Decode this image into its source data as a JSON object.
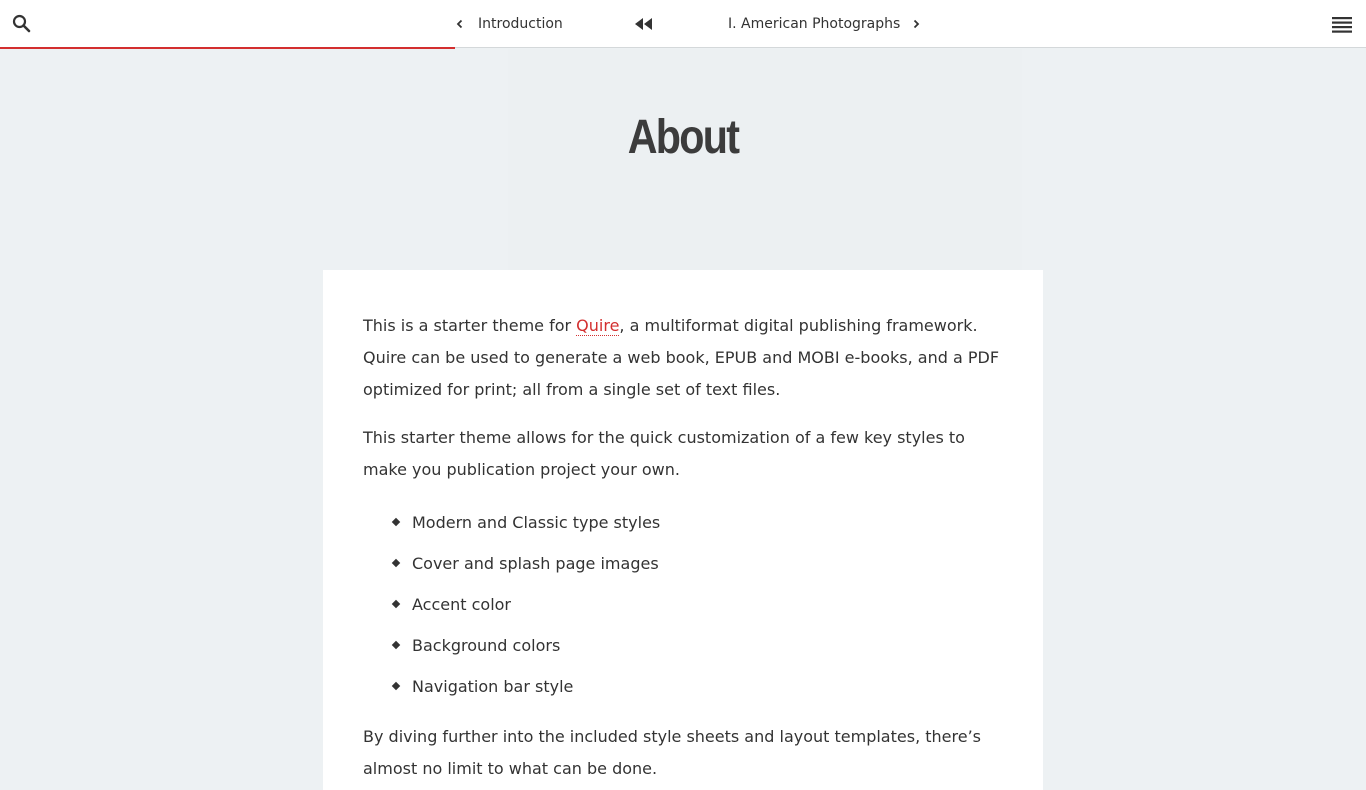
{
  "navbar": {
    "search_icon": "search-icon",
    "prev_label": "Introduction",
    "home_icon": "rewind-icon",
    "next_label": "I. American Photographs",
    "menu_icon": "menu-icon",
    "progress_fraction": 0.333,
    "accent_color": "#d32f2f"
  },
  "page": {
    "title": "About",
    "intro_before_link": "This is a starter theme for ",
    "intro_link": "Quire",
    "intro_after_link": ", a multiformat digital publishing framework. Quire can be used to generate a web book, EPUB and MOBI e-books, and a PDF optimized for print; all from a single set of text files.",
    "paragraph2": "This starter theme allows for the quick customization of a few key styles to make you publication project your own.",
    "list": [
      "Modern and Classic type styles",
      "Cover and splash page images",
      "Accent color",
      "Background colors",
      "Navigation bar style"
    ],
    "paragraph3": "By diving further into the included style sheets and layout templates, there’s almost no limit to what can be done."
  }
}
